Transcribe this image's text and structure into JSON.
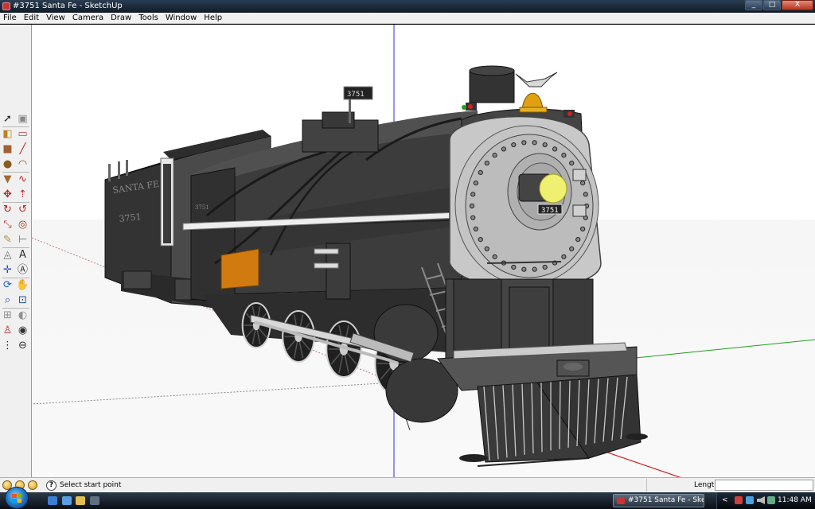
{
  "window": {
    "title": "#3751 Santa Fe - SketchUp",
    "controls": {
      "minimize": "_",
      "maximize": "□",
      "close": "X"
    }
  },
  "menu": [
    "File",
    "Edit",
    "View",
    "Camera",
    "Draw",
    "Tools",
    "Window",
    "Help"
  ],
  "tools": [
    {
      "name": "select-tool-icon"
    },
    {
      "name": "make-component-icon"
    },
    {
      "name": "paint-bucket-icon"
    },
    {
      "name": "eraser-icon"
    },
    {
      "name": "rectangle-tool-icon"
    },
    {
      "name": "line-tool-icon"
    },
    {
      "name": "circle-tool-icon"
    },
    {
      "name": "arc-tool-icon"
    },
    {
      "name": "polygon-tool-icon"
    },
    {
      "name": "freehand-tool-icon"
    },
    {
      "name": "move-tool-icon"
    },
    {
      "name": "push-pull-icon"
    },
    {
      "name": "rotate-tool-icon"
    },
    {
      "name": "follow-me-icon"
    },
    {
      "name": "scale-tool-icon"
    },
    {
      "name": "offset-tool-icon"
    },
    {
      "name": "tape-measure-icon"
    },
    {
      "name": "dimension-tool-icon"
    },
    {
      "name": "protractor-icon"
    },
    {
      "name": "text-tool-icon"
    },
    {
      "name": "axes-tool-icon"
    },
    {
      "name": "3d-text-icon"
    },
    {
      "name": "orbit-tool-icon"
    },
    {
      "name": "pan-tool-icon"
    },
    {
      "name": "zoom-tool-icon"
    },
    {
      "name": "zoom-window-icon"
    },
    {
      "name": "zoom-extents-icon"
    },
    {
      "name": "previous-view-icon"
    },
    {
      "name": "position-camera-icon"
    },
    {
      "name": "look-around-icon"
    },
    {
      "name": "walk-tool-icon"
    },
    {
      "name": "section-plane-icon"
    }
  ],
  "model": {
    "tender_lettering": "SANTA FE",
    "tender_number": "3751",
    "headlight_number": "3751",
    "number_board": "3751"
  },
  "status": {
    "prompt": "Select start point",
    "vcb_label": "Length",
    "vcb_value": ""
  },
  "taskbar": {
    "task_label": "#3751 Santa Fe - Ske...",
    "clock": "11:48 AM"
  },
  "colors": {
    "titlebar": "#1c2838",
    "locomotive_body": "#3a3a3a",
    "smokebox_front": "#c8c8c8",
    "bell": "#e0a010",
    "headlight": "#f0f070",
    "orange_panel": "#d07a10",
    "axis_red": "#d02020",
    "axis_green": "#20a020",
    "axis_blue": "#2020d0"
  }
}
